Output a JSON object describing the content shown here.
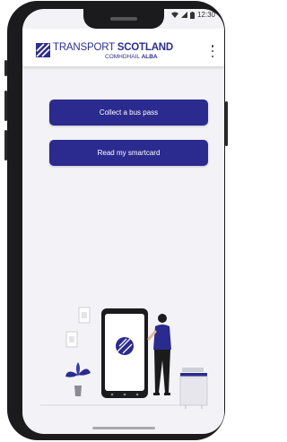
{
  "status": {
    "time": "12:30"
  },
  "header": {
    "brand_light": "TRANSPORT",
    "brand_bold": "SCOTLAND",
    "sub_light": "COMHDHAIL",
    "sub_bold": "ALBA"
  },
  "actions": {
    "collect_label": "Collect a bus pass",
    "read_label": "Read my smartcard"
  },
  "colors": {
    "accent": "#2b2a8f",
    "background": "#f3f2f6"
  },
  "icons": [
    "wifi-icon",
    "signal-icon",
    "battery-icon",
    "overflow-menu-icon",
    "transport-scotland-logo-icon"
  ]
}
